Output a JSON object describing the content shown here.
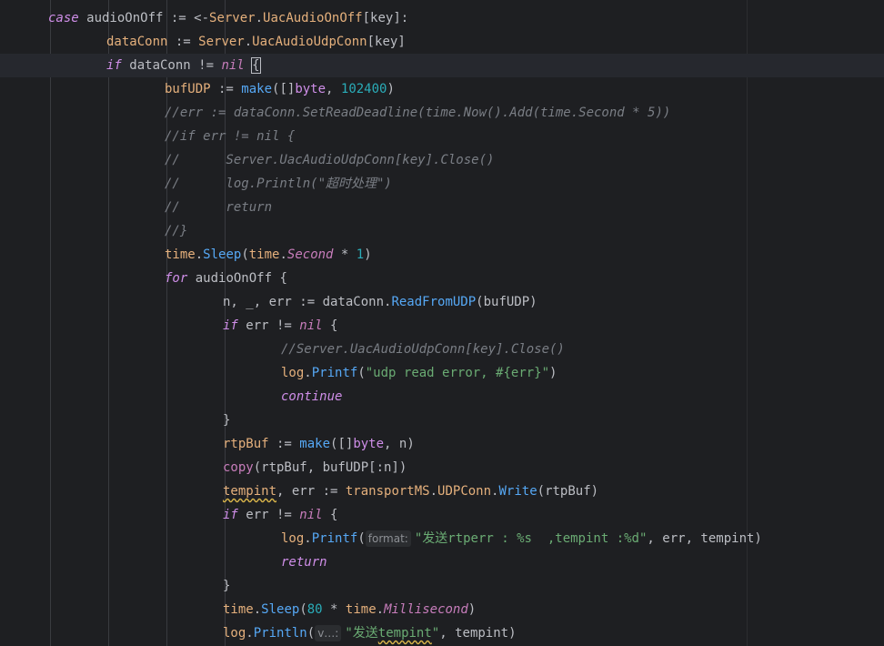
{
  "editor": {
    "lines": [
      [
        {
          "t": "case",
          "c": "kw"
        },
        {
          "t": " audioOnOff := <-",
          "c": "id"
        },
        {
          "t": "Server",
          "c": "pkg"
        },
        {
          "t": ".",
          "c": "op"
        },
        {
          "t": "UacAudioOnOff",
          "c": "var"
        },
        {
          "t": "[key]:",
          "c": "id"
        }
      ],
      [
        {
          "t": "dataConn",
          "c": "var"
        },
        {
          "t": " := ",
          "c": "op"
        },
        {
          "t": "Server",
          "c": "pkg"
        },
        {
          "t": ".",
          "c": "op"
        },
        {
          "t": "UacAudioUdpConn",
          "c": "var"
        },
        {
          "t": "[key]",
          "c": "id"
        }
      ],
      [
        {
          "t": "if",
          "c": "kw"
        },
        {
          "t": " dataConn != ",
          "c": "id"
        },
        {
          "t": "nil",
          "c": "const"
        },
        {
          "t": " ",
          "c": "id"
        },
        {
          "t": "{",
          "c": "id match"
        }
      ],
      [
        {
          "t": "bufUDP",
          "c": "var"
        },
        {
          "t": " := ",
          "c": "op"
        },
        {
          "t": "make",
          "c": "fn"
        },
        {
          "t": "([]",
          "c": "id"
        },
        {
          "t": "byte",
          "c": "type"
        },
        {
          "t": ", ",
          "c": "id"
        },
        {
          "t": "102400",
          "c": "num"
        },
        {
          "t": ")",
          "c": "id"
        }
      ],
      [
        {
          "t": "//err := dataConn.SetReadDeadline(time.Now().Add(time.Second * 5))",
          "c": "cmt"
        }
      ],
      [
        {
          "t": "//if err != nil {",
          "c": "cmt"
        }
      ],
      [
        {
          "t": "//      Server.UacAudioUdpConn[key].Close()",
          "c": "cmt"
        }
      ],
      [
        {
          "t": "//      log.Println(\"超时处理\")",
          "c": "cmt"
        }
      ],
      [
        {
          "t": "//      return",
          "c": "cmt"
        }
      ],
      [
        {
          "t": "//}",
          "c": "cmt"
        }
      ],
      [
        {
          "t": "time",
          "c": "pkg"
        },
        {
          "t": ".",
          "c": "op"
        },
        {
          "t": "Sleep",
          "c": "fn"
        },
        {
          "t": "(",
          "c": "id"
        },
        {
          "t": "time",
          "c": "pkg"
        },
        {
          "t": ".",
          "c": "op"
        },
        {
          "t": "Second",
          "c": "const"
        },
        {
          "t": " * ",
          "c": "op"
        },
        {
          "t": "1",
          "c": "num"
        },
        {
          "t": ")",
          "c": "id"
        }
      ],
      [
        {
          "t": "for",
          "c": "kw"
        },
        {
          "t": " audioOnOff {",
          "c": "id"
        }
      ],
      [
        {
          "t": "n, _, err := dataConn.",
          "c": "id"
        },
        {
          "t": "ReadFromUDP",
          "c": "fn"
        },
        {
          "t": "(bufUDP)",
          "c": "id"
        }
      ],
      [
        {
          "t": "if",
          "c": "kw"
        },
        {
          "t": " err != ",
          "c": "id"
        },
        {
          "t": "nil",
          "c": "const"
        },
        {
          "t": " {",
          "c": "id"
        }
      ],
      [
        {
          "t": "//Server.UacAudioUdpConn[key].Close()",
          "c": "cmt"
        }
      ],
      [
        {
          "t": "log",
          "c": "pkg"
        },
        {
          "t": ".",
          "c": "op"
        },
        {
          "t": "Printf",
          "c": "fn"
        },
        {
          "t": "(",
          "c": "id"
        },
        {
          "t": "\"udp read error, #{err}\"",
          "c": "str"
        },
        {
          "t": ")",
          "c": "id"
        }
      ],
      [
        {
          "t": "continue",
          "c": "kw"
        }
      ],
      [
        {
          "t": "}",
          "c": "id"
        }
      ],
      [
        {
          "t": "rtpBuf",
          "c": "var"
        },
        {
          "t": " := ",
          "c": "op"
        },
        {
          "t": "make",
          "c": "fn"
        },
        {
          "t": "([]",
          "c": "id"
        },
        {
          "t": "byte",
          "c": "type"
        },
        {
          "t": ", n)",
          "c": "id"
        }
      ],
      [
        {
          "t": "copy",
          "c": "builtin"
        },
        {
          "t": "(rtpBuf, bufUDP[:n])",
          "c": "id"
        }
      ],
      [
        {
          "t": "tempint",
          "c": "var warn"
        },
        {
          "t": ", err := ",
          "c": "id"
        },
        {
          "t": "transportMS",
          "c": "pkg"
        },
        {
          "t": ".",
          "c": "op"
        },
        {
          "t": "UDPConn",
          "c": "var"
        },
        {
          "t": ".",
          "c": "op"
        },
        {
          "t": "Write",
          "c": "fn"
        },
        {
          "t": "(rtpBuf)",
          "c": "id"
        }
      ],
      [
        {
          "t": "if",
          "c": "kw"
        },
        {
          "t": " err != ",
          "c": "id"
        },
        {
          "t": "nil",
          "c": "const"
        },
        {
          "t": " {",
          "c": "id"
        }
      ],
      [
        {
          "t": "log",
          "c": "pkg"
        },
        {
          "t": ".",
          "c": "op"
        },
        {
          "t": "Printf",
          "c": "fn"
        },
        {
          "t": "(",
          "c": "id"
        },
        {
          "t": "format:",
          "c": "hint"
        },
        {
          "t": "\"发送rtperr : %s  ,tempint :%d\"",
          "c": "str"
        },
        {
          "t": ", err, tempint)",
          "c": "id"
        }
      ],
      [
        {
          "t": "return",
          "c": "kw"
        }
      ],
      [
        {
          "t": "}",
          "c": "id"
        }
      ],
      [
        {
          "t": "time",
          "c": "pkg"
        },
        {
          "t": ".",
          "c": "op"
        },
        {
          "t": "Sleep",
          "c": "fn"
        },
        {
          "t": "(",
          "c": "id"
        },
        {
          "t": "80",
          "c": "num"
        },
        {
          "t": " * ",
          "c": "op"
        },
        {
          "t": "time",
          "c": "pkg"
        },
        {
          "t": ".",
          "c": "op"
        },
        {
          "t": "Millisecond",
          "c": "const"
        },
        {
          "t": ")",
          "c": "id"
        }
      ],
      [
        {
          "t": "log",
          "c": "pkg"
        },
        {
          "t": ".",
          "c": "op"
        },
        {
          "t": "Println",
          "c": "fn"
        },
        {
          "t": "(",
          "c": "id"
        },
        {
          "t": "v…:",
          "c": "hint"
        },
        {
          "t": "\"发送",
          "c": "str"
        },
        {
          "t": "tempint",
          "c": "str warn"
        },
        {
          "t": "\"",
          "c": "str"
        },
        {
          "t": ", tempint)",
          "c": "id"
        }
      ]
    ]
  }
}
